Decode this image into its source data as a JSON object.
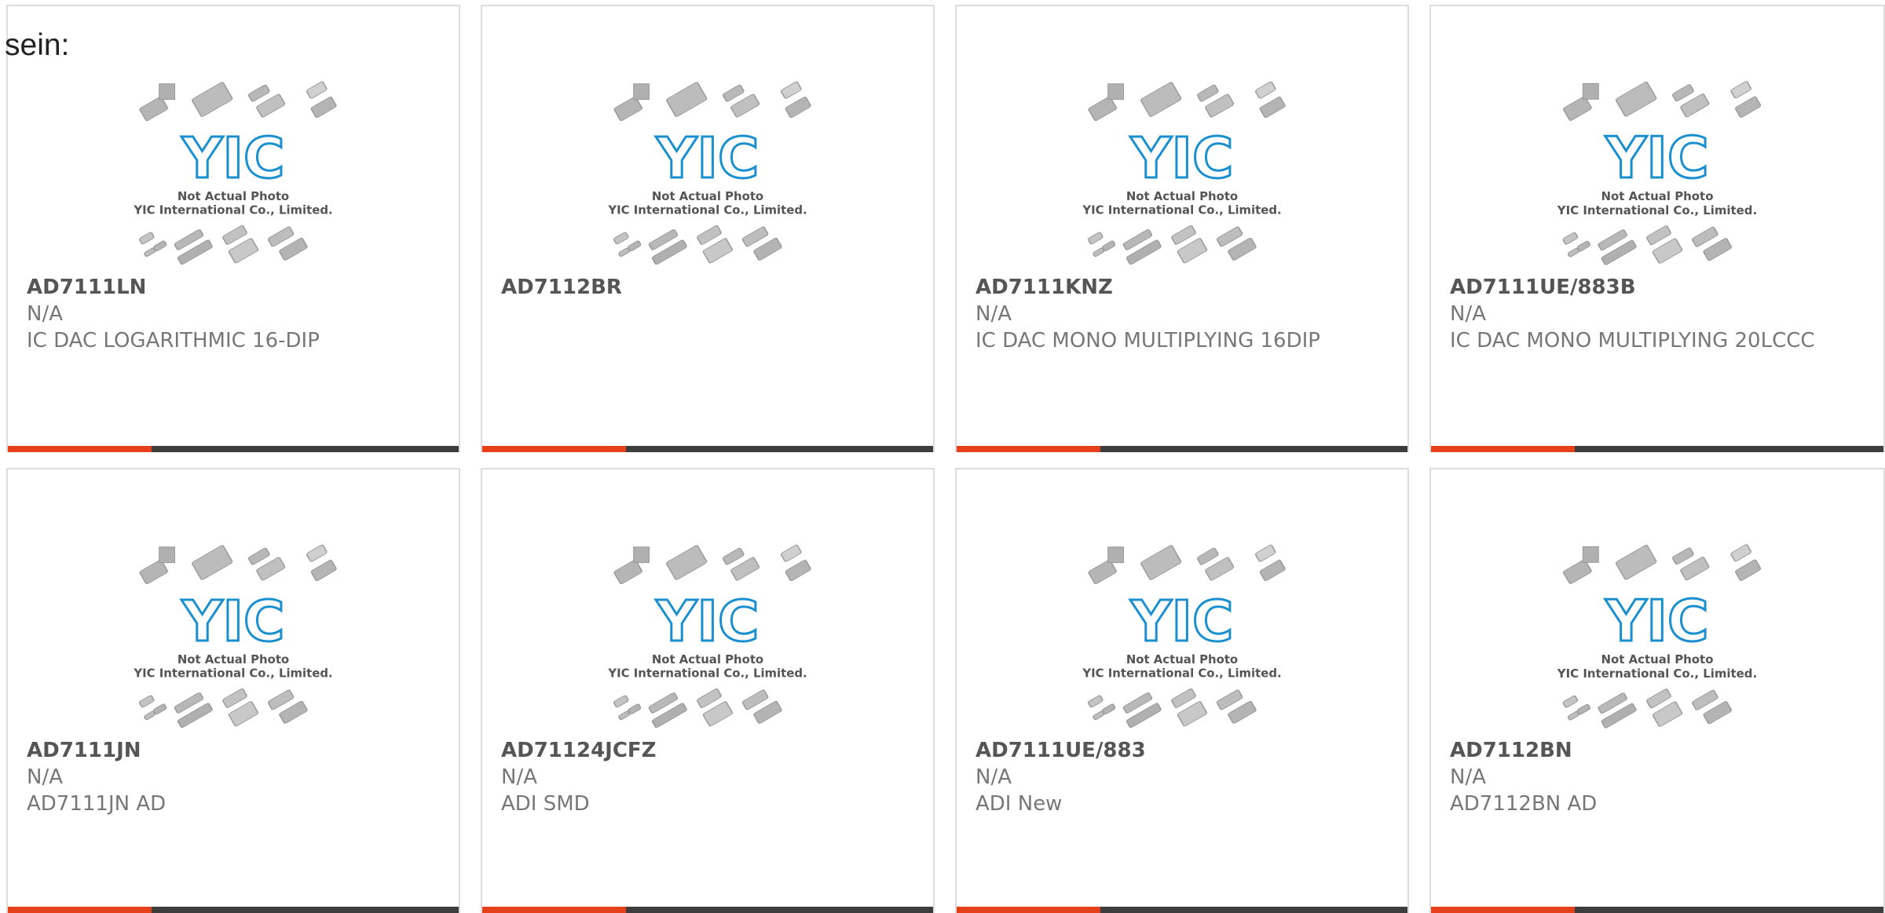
{
  "intro_text": "sein:",
  "image_placeholder": {
    "line1": "Not Actual Photo",
    "line2": "YIC International Co., Limited.",
    "logo_text": "YIC"
  },
  "colors": {
    "accent": "#e6401a",
    "bar": "#3d3d3d",
    "logo": "#1a8fd0",
    "border": "#dcdcdc"
  },
  "products": [
    {
      "part": "AD7111LN",
      "stock": "N/A",
      "desc": "IC DAC LOGARITHMIC 16-DIP"
    },
    {
      "part": "AD7112BR",
      "stock": "",
      "desc": ""
    },
    {
      "part": "AD7111KNZ",
      "stock": "N/A",
      "desc": "IC DAC MONO MULTIPLYING 16DIP"
    },
    {
      "part": "AD7111UE/883B",
      "stock": "N/A",
      "desc": "IC DAC MONO MULTIPLYING 20LCCC"
    },
    {
      "part": "AD7111JN",
      "stock": "N/A",
      "desc": "AD7111JN AD"
    },
    {
      "part": "AD71124JCFZ",
      "stock": "N/A",
      "desc": "ADI SMD"
    },
    {
      "part": "AD7111UE/883",
      "stock": "N/A",
      "desc": "ADI New"
    },
    {
      "part": "AD7112BN",
      "stock": "N/A",
      "desc": "AD7112BN AD"
    }
  ]
}
